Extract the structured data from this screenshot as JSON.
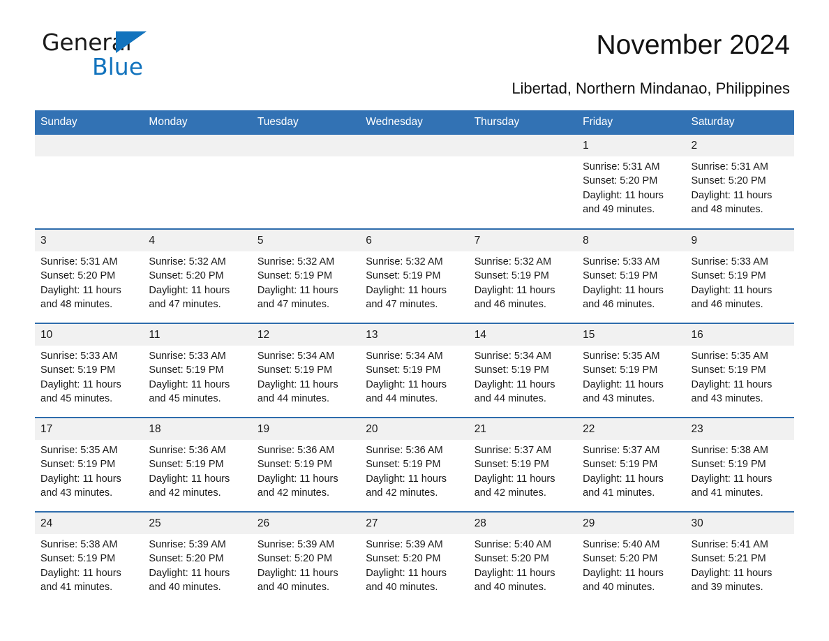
{
  "brand": {
    "name_line1": "General",
    "name_line2": "Blue",
    "accent_color": "#1273bd",
    "header_color": "#3272b4"
  },
  "header": {
    "title": "November 2024",
    "subtitle": "Libertad, Northern Mindanao, Philippines"
  },
  "weekday_headers": [
    "Sunday",
    "Monday",
    "Tuesday",
    "Wednesday",
    "Thursday",
    "Friday",
    "Saturday"
  ],
  "labels": {
    "sunrise": "Sunrise:",
    "sunset": "Sunset:",
    "daylight": "Daylight:"
  },
  "weeks": [
    [
      {
        "day": "",
        "sunrise": "",
        "sunset": "",
        "daylight": "",
        "daylight2": ""
      },
      {
        "day": "",
        "sunrise": "",
        "sunset": "",
        "daylight": "",
        "daylight2": ""
      },
      {
        "day": "",
        "sunrise": "",
        "sunset": "",
        "daylight": "",
        "daylight2": ""
      },
      {
        "day": "",
        "sunrise": "",
        "sunset": "",
        "daylight": "",
        "daylight2": ""
      },
      {
        "day": "",
        "sunrise": "",
        "sunset": "",
        "daylight": "",
        "daylight2": ""
      },
      {
        "day": "1",
        "sunrise": "Sunrise: 5:31 AM",
        "sunset": "Sunset: 5:20 PM",
        "daylight": "Daylight: 11 hours",
        "daylight2": "and 49 minutes."
      },
      {
        "day": "2",
        "sunrise": "Sunrise: 5:31 AM",
        "sunset": "Sunset: 5:20 PM",
        "daylight": "Daylight: 11 hours",
        "daylight2": "and 48 minutes."
      }
    ],
    [
      {
        "day": "3",
        "sunrise": "Sunrise: 5:31 AM",
        "sunset": "Sunset: 5:20 PM",
        "daylight": "Daylight: 11 hours",
        "daylight2": "and 48 minutes."
      },
      {
        "day": "4",
        "sunrise": "Sunrise: 5:32 AM",
        "sunset": "Sunset: 5:20 PM",
        "daylight": "Daylight: 11 hours",
        "daylight2": "and 47 minutes."
      },
      {
        "day": "5",
        "sunrise": "Sunrise: 5:32 AM",
        "sunset": "Sunset: 5:19 PM",
        "daylight": "Daylight: 11 hours",
        "daylight2": "and 47 minutes."
      },
      {
        "day": "6",
        "sunrise": "Sunrise: 5:32 AM",
        "sunset": "Sunset: 5:19 PM",
        "daylight": "Daylight: 11 hours",
        "daylight2": "and 47 minutes."
      },
      {
        "day": "7",
        "sunrise": "Sunrise: 5:32 AM",
        "sunset": "Sunset: 5:19 PM",
        "daylight": "Daylight: 11 hours",
        "daylight2": "and 46 minutes."
      },
      {
        "day": "8",
        "sunrise": "Sunrise: 5:33 AM",
        "sunset": "Sunset: 5:19 PM",
        "daylight": "Daylight: 11 hours",
        "daylight2": "and 46 minutes."
      },
      {
        "day": "9",
        "sunrise": "Sunrise: 5:33 AM",
        "sunset": "Sunset: 5:19 PM",
        "daylight": "Daylight: 11 hours",
        "daylight2": "and 46 minutes."
      }
    ],
    [
      {
        "day": "10",
        "sunrise": "Sunrise: 5:33 AM",
        "sunset": "Sunset: 5:19 PM",
        "daylight": "Daylight: 11 hours",
        "daylight2": "and 45 minutes."
      },
      {
        "day": "11",
        "sunrise": "Sunrise: 5:33 AM",
        "sunset": "Sunset: 5:19 PM",
        "daylight": "Daylight: 11 hours",
        "daylight2": "and 45 minutes."
      },
      {
        "day": "12",
        "sunrise": "Sunrise: 5:34 AM",
        "sunset": "Sunset: 5:19 PM",
        "daylight": "Daylight: 11 hours",
        "daylight2": "and 44 minutes."
      },
      {
        "day": "13",
        "sunrise": "Sunrise: 5:34 AM",
        "sunset": "Sunset: 5:19 PM",
        "daylight": "Daylight: 11 hours",
        "daylight2": "and 44 minutes."
      },
      {
        "day": "14",
        "sunrise": "Sunrise: 5:34 AM",
        "sunset": "Sunset: 5:19 PM",
        "daylight": "Daylight: 11 hours",
        "daylight2": "and 44 minutes."
      },
      {
        "day": "15",
        "sunrise": "Sunrise: 5:35 AM",
        "sunset": "Sunset: 5:19 PM",
        "daylight": "Daylight: 11 hours",
        "daylight2": "and 43 minutes."
      },
      {
        "day": "16",
        "sunrise": "Sunrise: 5:35 AM",
        "sunset": "Sunset: 5:19 PM",
        "daylight": "Daylight: 11 hours",
        "daylight2": "and 43 minutes."
      }
    ],
    [
      {
        "day": "17",
        "sunrise": "Sunrise: 5:35 AM",
        "sunset": "Sunset: 5:19 PM",
        "daylight": "Daylight: 11 hours",
        "daylight2": "and 43 minutes."
      },
      {
        "day": "18",
        "sunrise": "Sunrise: 5:36 AM",
        "sunset": "Sunset: 5:19 PM",
        "daylight": "Daylight: 11 hours",
        "daylight2": "and 42 minutes."
      },
      {
        "day": "19",
        "sunrise": "Sunrise: 5:36 AM",
        "sunset": "Sunset: 5:19 PM",
        "daylight": "Daylight: 11 hours",
        "daylight2": "and 42 minutes."
      },
      {
        "day": "20",
        "sunrise": "Sunrise: 5:36 AM",
        "sunset": "Sunset: 5:19 PM",
        "daylight": "Daylight: 11 hours",
        "daylight2": "and 42 minutes."
      },
      {
        "day": "21",
        "sunrise": "Sunrise: 5:37 AM",
        "sunset": "Sunset: 5:19 PM",
        "daylight": "Daylight: 11 hours",
        "daylight2": "and 42 minutes."
      },
      {
        "day": "22",
        "sunrise": "Sunrise: 5:37 AM",
        "sunset": "Sunset: 5:19 PM",
        "daylight": "Daylight: 11 hours",
        "daylight2": "and 41 minutes."
      },
      {
        "day": "23",
        "sunrise": "Sunrise: 5:38 AM",
        "sunset": "Sunset: 5:19 PM",
        "daylight": "Daylight: 11 hours",
        "daylight2": "and 41 minutes."
      }
    ],
    [
      {
        "day": "24",
        "sunrise": "Sunrise: 5:38 AM",
        "sunset": "Sunset: 5:19 PM",
        "daylight": "Daylight: 11 hours",
        "daylight2": "and 41 minutes."
      },
      {
        "day": "25",
        "sunrise": "Sunrise: 5:39 AM",
        "sunset": "Sunset: 5:20 PM",
        "daylight": "Daylight: 11 hours",
        "daylight2": "and 40 minutes."
      },
      {
        "day": "26",
        "sunrise": "Sunrise: 5:39 AM",
        "sunset": "Sunset: 5:20 PM",
        "daylight": "Daylight: 11 hours",
        "daylight2": "and 40 minutes."
      },
      {
        "day": "27",
        "sunrise": "Sunrise: 5:39 AM",
        "sunset": "Sunset: 5:20 PM",
        "daylight": "Daylight: 11 hours",
        "daylight2": "and 40 minutes."
      },
      {
        "day": "28",
        "sunrise": "Sunrise: 5:40 AM",
        "sunset": "Sunset: 5:20 PM",
        "daylight": "Daylight: 11 hours",
        "daylight2": "and 40 minutes."
      },
      {
        "day": "29",
        "sunrise": "Sunrise: 5:40 AM",
        "sunset": "Sunset: 5:20 PM",
        "daylight": "Daylight: 11 hours",
        "daylight2": "and 40 minutes."
      },
      {
        "day": "30",
        "sunrise": "Sunrise: 5:41 AM",
        "sunset": "Sunset: 5:21 PM",
        "daylight": "Daylight: 11 hours",
        "daylight2": "and 39 minutes."
      }
    ]
  ]
}
